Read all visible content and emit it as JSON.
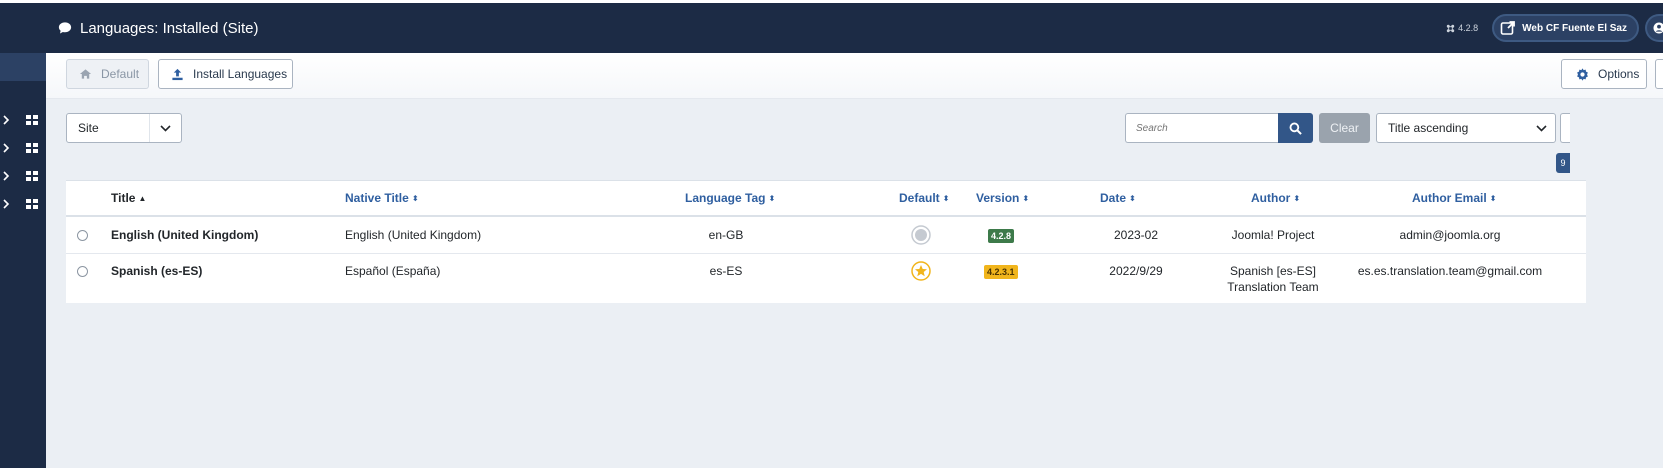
{
  "header": {
    "title": "Languages: Installed (Site)",
    "version": "4.2.8",
    "site_name": "Web CF Fuente El Saz"
  },
  "toolbar": {
    "default_label": "Default",
    "install_label": "Install Languages",
    "options_label": "Options"
  },
  "filters": {
    "client_value": "Site",
    "search_placeholder": "Search",
    "clear_label": "Clear",
    "sort_value": "Title ascending",
    "count_badge": "9"
  },
  "table": {
    "columns": {
      "title": "Title",
      "native_title": "Native Title",
      "language_tag": "Language Tag",
      "default": "Default",
      "version": "Version",
      "date": "Date",
      "author": "Author",
      "author_email": "Author Email"
    },
    "rows": [
      {
        "title": "English (United Kingdom)",
        "native_title": "English (United Kingdom)",
        "tag": "en-GB",
        "is_default": false,
        "version": "4.2.8",
        "date": "2023-02",
        "author_line1": "Joomla! Project",
        "author_line2": "",
        "email": "admin@joomla.org"
      },
      {
        "title": "Spanish (es-ES)",
        "native_title": "Español (España)",
        "tag": "es-ES",
        "is_default": true,
        "version": "4.2.3.1",
        "date": "2022/9/29",
        "author_line1": "Spanish [es-ES]",
        "author_line2": "Translation Team",
        "email": "es.es.translation.team@gmail.com"
      }
    ]
  },
  "colors": {
    "navy": "#1c2b45",
    "link_blue": "#2f5fa0",
    "primary": "#325688",
    "version_green": "#3d7a4a",
    "version_yellow": "#f1b51c",
    "default_star": "#f1b51c"
  }
}
